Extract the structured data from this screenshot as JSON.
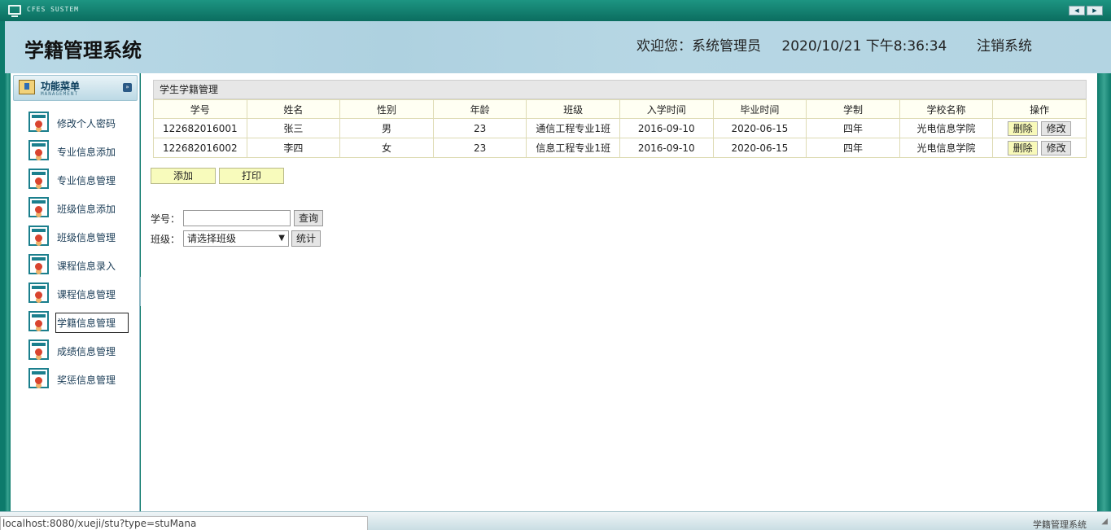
{
  "window": {
    "system_title": "CFES SUSTEM",
    "nav_prev": "◀",
    "nav_next": "▶"
  },
  "header": {
    "app_title": "学籍管理系统",
    "welcome": "欢迎您：系统管理员",
    "datetime": "2020/10/21 下午8:36:34",
    "logout": "注销系统"
  },
  "sidebar": {
    "title": "功能菜单",
    "subtitle": "MANAGEMENT",
    "collapse_glyph": "»",
    "items": [
      {
        "label": "修改个人密码"
      },
      {
        "label": "专业信息添加"
      },
      {
        "label": "专业信息管理"
      },
      {
        "label": "班级信息添加"
      },
      {
        "label": "班级信息管理"
      },
      {
        "label": "课程信息录入"
      },
      {
        "label": "课程信息管理"
      },
      {
        "label": "学籍信息管理"
      },
      {
        "label": "成绩信息管理"
      },
      {
        "label": "奖惩信息管理"
      }
    ],
    "active_index": 7
  },
  "panel": {
    "title": "学生学籍管理",
    "columns": [
      "学号",
      "姓名",
      "性别",
      "年龄",
      "班级",
      "入学时间",
      "毕业时间",
      "学制",
      "学校名称",
      "操作"
    ],
    "rows": [
      {
        "id": "122682016001",
        "name": "张三",
        "gender": "男",
        "age": "23",
        "class": "通信工程专业1班",
        "enroll": "2016-09-10",
        "graduate": "2020-06-15",
        "duration": "四年",
        "school": "光电信息学院"
      },
      {
        "id": "122682016002",
        "name": "李四",
        "gender": "女",
        "age": "23",
        "class": "信息工程专业1班",
        "enroll": "2016-09-10",
        "graduate": "2020-06-15",
        "duration": "四年",
        "school": "光电信息学院"
      }
    ],
    "delete_label": "删除",
    "edit_label": "修改"
  },
  "actions": {
    "add": "添加",
    "print": "打印"
  },
  "search": {
    "id_label": "学号：",
    "id_value": "",
    "query_button": "查询",
    "class_label": "班级：",
    "class_selected": "请选择班级",
    "stats_button": "统计"
  },
  "footer": {
    "text": "学籍管理系统",
    "status_url": "localhost:8080/xueji/stu?type=stuMana"
  }
}
